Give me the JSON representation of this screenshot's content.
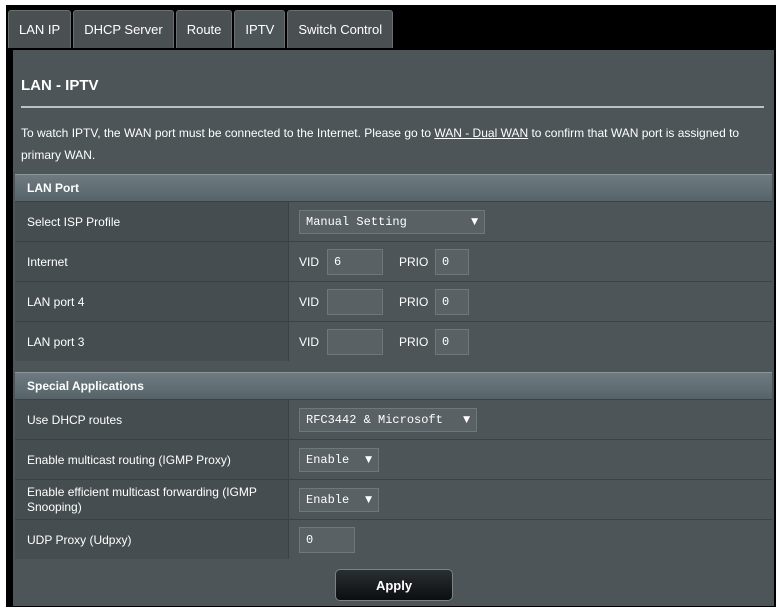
{
  "tabs": [
    "LAN IP",
    "DHCP Server",
    "Route",
    "IPTV",
    "Switch Control"
  ],
  "page": {
    "title": "LAN - IPTV",
    "desc_before": "To watch IPTV, the WAN port must be connected to the Internet. Please go to ",
    "desc_link": "WAN - Dual WAN",
    "desc_after": " to confirm that WAN port is assigned to primary WAN."
  },
  "lan_port": {
    "header": "LAN Port",
    "isp_label": "Select ISP Profile",
    "isp_value": "Manual Setting",
    "vid_label": "VID",
    "prio_label": "PRIO",
    "rows": [
      {
        "label": "Internet",
        "vid": "6",
        "prio": "0"
      },
      {
        "label": "LAN port 4",
        "vid": "",
        "prio": "0"
      },
      {
        "label": "LAN port 3",
        "vid": "",
        "prio": "0"
      }
    ]
  },
  "special": {
    "header": "Special Applications",
    "dhcp_routes_label": "Use DHCP routes",
    "dhcp_routes_value": "RFC3442 & Microsoft",
    "igmp_proxy_label": "Enable multicast routing (IGMP Proxy)",
    "igmp_proxy_value": "Enable",
    "igmp_snoop_label": "Enable efficient multicast forwarding (IGMP Snooping)",
    "igmp_snoop_value": "Enable",
    "udpxy_label": "UDP Proxy (Udpxy)",
    "udpxy_value": "0"
  },
  "apply_label": "Apply",
  "dropdown_icon": "triangle-down"
}
